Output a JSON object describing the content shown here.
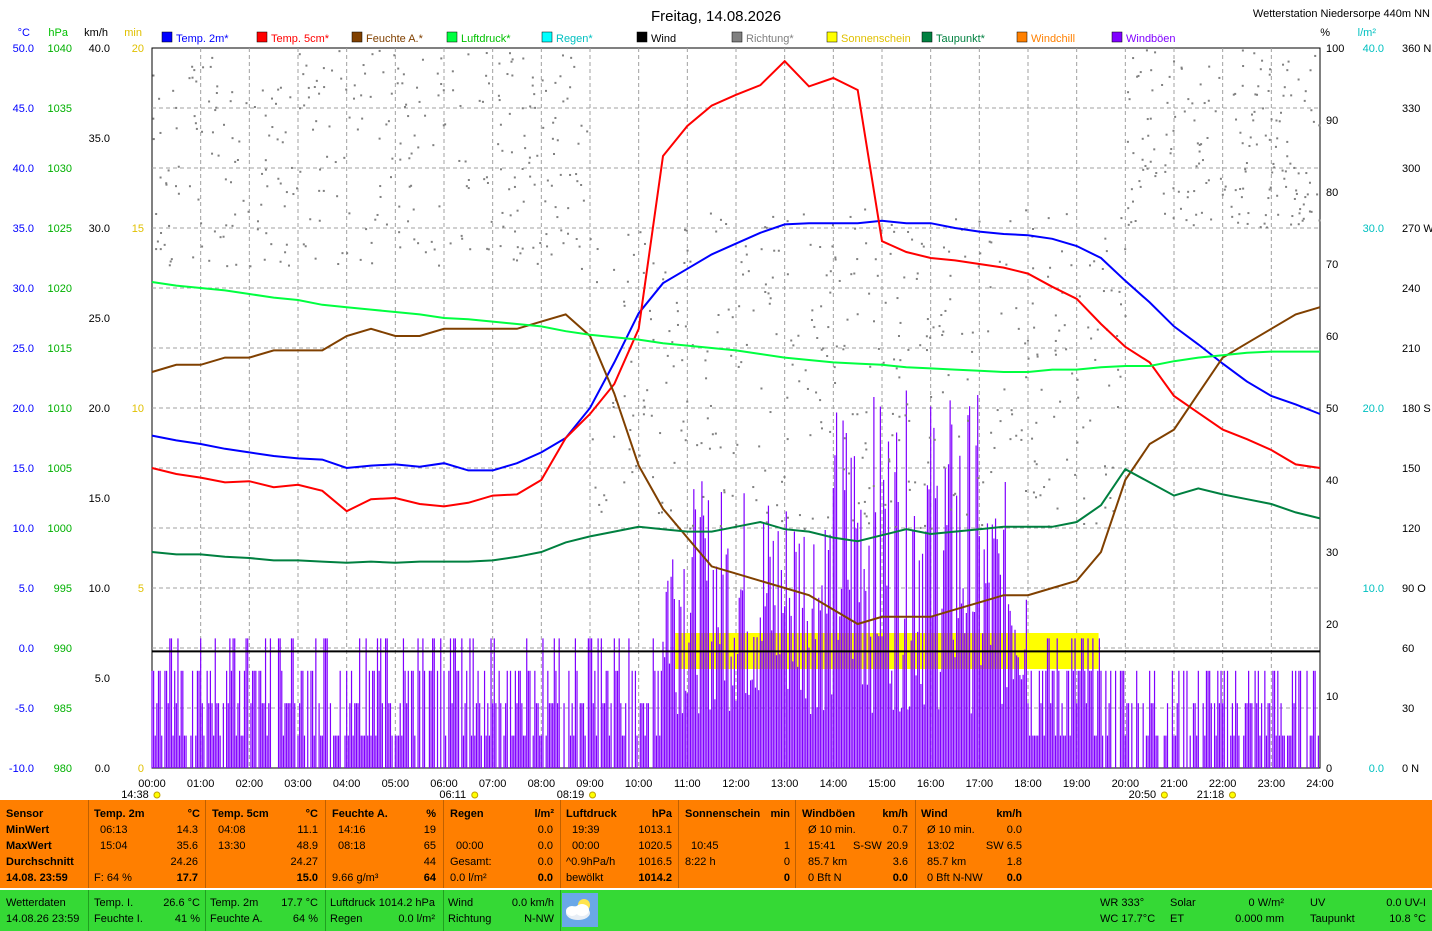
{
  "header": {
    "date_title": "Freitag, 14.08.2026",
    "station": "Wetterstation Niedersorpe 440m NN"
  },
  "legend": [
    {
      "label": "Temp. 2m*",
      "color": "#0000ff",
      "name": "legend-temp2m"
    },
    {
      "label": "Temp. 5cm*",
      "color": "#ff0000",
      "name": "legend-temp5cm"
    },
    {
      "label": "Feuchte A.*",
      "color": "#804000",
      "name": "legend-feuchte"
    },
    {
      "label": "Luftdruck*",
      "color": "#00ff40",
      "name": "legend-luftdruck"
    },
    {
      "label": "Regen*",
      "color": "#00ffff",
      "name": "legend-regen"
    },
    {
      "label": "Wind",
      "color": "#000000",
      "name": "legend-wind"
    },
    {
      "label": "Richtung*",
      "color": "#808080",
      "name": "legend-richtung"
    },
    {
      "label": "Sonnenschein",
      "color": "#ffff00",
      "name": "legend-sonnenschein"
    },
    {
      "label": "Taupunkt*",
      "color": "#008040",
      "name": "legend-taupunkt"
    },
    {
      "label": "Windchill",
      "color": "#ff8000",
      "name": "legend-windchill"
    },
    {
      "label": "Windböen",
      "color": "#8000ff",
      "name": "legend-windboeen"
    }
  ],
  "axis_units": {
    "temp": "°C",
    "hpa": "hPa",
    "kmh": "km/h",
    "min": "min",
    "percent": "%",
    "lm2": "l/m²"
  },
  "axes": {
    "temp": [
      "50.0",
      "45.0",
      "40.0",
      "35.0",
      "30.0",
      "25.0",
      "20.0",
      "15.0",
      "10.0",
      "5.0",
      "0.0",
      "-5.0",
      "-10.0"
    ],
    "hpa": [
      "1040",
      "1035",
      "1030",
      "1025",
      "1020",
      "1015",
      "1010",
      "1005",
      "1000",
      "995",
      "990",
      "985",
      "980"
    ],
    "kmh": [
      "40.0",
      "35.0",
      "30.0",
      "25.0",
      "20.0",
      "15.0",
      "10.0",
      "5.0",
      "0.0"
    ],
    "min": [
      "20",
      "15",
      "10",
      "5",
      "0"
    ],
    "percent": [
      "100",
      "90",
      "80",
      "70",
      "60",
      "50",
      "40",
      "30",
      "20",
      "10",
      "0"
    ],
    "lm2": [
      "40.0",
      "30.0",
      "20.0",
      "10.0",
      "0.0"
    ],
    "dir": [
      "360 N",
      "330",
      "300",
      "270 W",
      "240",
      "210",
      "180 S",
      "150",
      "120",
      "90 O",
      "60",
      "30",
      "0 N"
    ],
    "time": [
      "00:00",
      "01:00",
      "02:00",
      "03:00",
      "04:00",
      "05:00",
      "06:00",
      "07:00",
      "08:00",
      "09:00",
      "10:00",
      "11:00",
      "12:00",
      "13:00",
      "14:00",
      "15:00",
      "16:00",
      "17:00",
      "18:00",
      "19:00",
      "20:00",
      "21:00",
      "22:00",
      "23:00",
      "24:00"
    ]
  },
  "astro": {
    "moonrise": "14:38",
    "sunrise": "06:11",
    "sunrise2": "08:19",
    "sunset": "20:50",
    "sunset2": "21:18"
  },
  "chart_data": {
    "type": "line",
    "title": "Freitag, 14.08.2026",
    "x": [
      0,
      0.5,
      1,
      1.5,
      2,
      2.5,
      3,
      3.5,
      4,
      4.5,
      5,
      5.5,
      6,
      6.5,
      7,
      7.5,
      8,
      8.5,
      9,
      9.5,
      10,
      10.5,
      11,
      11.5,
      12,
      12.5,
      13,
      13.5,
      14,
      14.5,
      15,
      15.5,
      16,
      16.5,
      17,
      17.5,
      18,
      18.5,
      19,
      19.5,
      20,
      20.5,
      21,
      21.5,
      22,
      22.5,
      23,
      23.5,
      24
    ],
    "series": [
      {
        "name": "Temp. 2m*",
        "axis": "°C",
        "color": "#0000ff",
        "values": [
          17.7,
          17.3,
          17.0,
          16.6,
          16.3,
          16.0,
          15.8,
          15.7,
          15.0,
          15.2,
          15.3,
          15.1,
          15.4,
          14.8,
          14.8,
          15.4,
          16.3,
          17.5,
          20.0,
          23.8,
          27.9,
          30.4,
          31.6,
          32.8,
          33.7,
          34.6,
          35.3,
          35.4,
          35.4,
          35.4,
          35.6,
          35.4,
          35.4,
          35.0,
          34.7,
          34.5,
          34.4,
          34.1,
          33.5,
          32.5,
          30.6,
          28.8,
          26.8,
          25.3,
          23.7,
          22.2,
          21.0,
          20.3,
          19.5
        ]
      },
      {
        "name": "Temp. 5cm*",
        "axis": "°C",
        "color": "#ff0000",
        "values": [
          15.0,
          14.5,
          14.2,
          13.8,
          13.9,
          13.4,
          13.6,
          13.1,
          11.4,
          12.4,
          12.5,
          12.0,
          11.8,
          12.1,
          12.7,
          12.8,
          14.0,
          17.5,
          19.5,
          22.0,
          26.6,
          41.0,
          43.5,
          45.2,
          46.1,
          46.9,
          48.9,
          46.8,
          47.5,
          46.5,
          33.9,
          33.0,
          32.5,
          32.3,
          32.0,
          31.7,
          31.2,
          30.1,
          29.1,
          27.0,
          25.1,
          23.8,
          21.0,
          19.6,
          18.2,
          17.4,
          16.5,
          15.3,
          15.0
        ]
      },
      {
        "name": "Feuchte A.*",
        "axis": "%",
        "color": "#804000",
        "values": [
          55,
          56,
          56,
          57,
          57,
          58,
          58,
          58,
          60,
          61,
          60,
          60,
          61,
          61,
          61,
          61,
          62,
          63,
          60,
          52,
          42,
          36,
          32,
          28,
          27,
          26,
          25,
          24,
          22,
          20,
          21,
          21,
          21,
          22,
          23,
          24,
          24,
          25,
          26,
          30,
          40,
          45,
          47,
          52,
          57,
          59,
          61,
          63,
          64
        ]
      },
      {
        "name": "Luftdruck*",
        "axis": "hPa",
        "color": "#00ff40",
        "values": [
          1020.5,
          1020.2,
          1020.0,
          1019.8,
          1019.5,
          1019.2,
          1019.0,
          1018.6,
          1018.4,
          1018.2,
          1018.0,
          1017.8,
          1017.5,
          1017.4,
          1017.2,
          1017.0,
          1016.8,
          1016.4,
          1016.1,
          1015.9,
          1015.7,
          1015.4,
          1015.2,
          1015.0,
          1014.8,
          1014.5,
          1014.2,
          1014.0,
          1013.8,
          1013.7,
          1013.6,
          1013.4,
          1013.3,
          1013.2,
          1013.1,
          1013.0,
          1013.0,
          1013.2,
          1013.2,
          1013.4,
          1013.5,
          1013.5,
          1013.9,
          1014.2,
          1014.4,
          1014.6,
          1014.7,
          1014.7,
          1014.7
        ]
      },
      {
        "name": "Taupunkt*",
        "axis": "°C",
        "color": "#008040",
        "values": [
          8.0,
          7.8,
          7.8,
          7.6,
          7.5,
          7.3,
          7.3,
          7.2,
          7.1,
          7.2,
          7.1,
          7.2,
          7.2,
          7.2,
          7.3,
          7.6,
          8.0,
          8.8,
          9.3,
          9.7,
          10.1,
          9.9,
          9.7,
          9.7,
          10.1,
          10.5,
          9.9,
          9.7,
          9.2,
          8.9,
          9.4,
          9.9,
          9.5,
          9.7,
          9.9,
          10.1,
          10.1,
          10.1,
          10.5,
          11.9,
          14.9,
          13.8,
          12.7,
          13.3,
          12.8,
          12.4,
          12.0,
          11.3,
          10.8
        ]
      }
    ],
    "wind_kmh": {
      "mean_level": 5.4,
      "max": 6.5
    },
    "gusts_kmh": {
      "max": 20.9
    },
    "sunshine_bars": {
      "from": 10.75,
      "to": 19.45
    }
  },
  "table": {
    "col_sensor": {
      "title": "Sensor",
      "rows": [
        "MinWert",
        "MaxWert",
        "Durchschnitt"
      ],
      "footer_date": "14.08. 23:59"
    },
    "col_temp2m": {
      "title": "Temp. 2m",
      "unit": "°C",
      "min_time": "06:13",
      "min": "14.3",
      "max_time": "15:04",
      "max": "35.6",
      "avg": "24.26",
      "footer_label": "F: 64 %",
      "footer_val": "17.7"
    },
    "col_temp5cm": {
      "title": "Temp. 5cm",
      "unit": "°C",
      "min_time": "04:08",
      "min": "11.1",
      "max_time": "13:30",
      "max": "48.9",
      "avg": "24.27",
      "footer_val": "15.0"
    },
    "col_feuchte": {
      "title": "Feuchte A.",
      "unit": "%",
      "min_time": "14:16",
      "min": "19",
      "max_time": "08:18",
      "max": "65",
      "avg": "44",
      "footer_label": "9.66 g/m³",
      "footer_val": "64"
    },
    "col_regen": {
      "title": "Regen",
      "unit": "l/m²",
      "r1": "0.0",
      "r2_time": "00:00",
      "r2": "0.0",
      "r3_label": "Gesamt:",
      "r3": "0.0",
      "footer_label": "0.0 l/m²",
      "footer_val": "0.0"
    },
    "col_luftdruck": {
      "title": "Luftdruck",
      "unit": "hPa",
      "min_time": "19:39",
      "min": "1013.1",
      "max_time": "00:00",
      "max": "1020.5",
      "avg_label": "^0.9hPa/h",
      "avg": "1016.5",
      "footer_label": "bewölkt",
      "footer_val": "1014.2"
    },
    "col_sonne": {
      "title": "Sonnenschein",
      "unit": "min",
      "r1": "",
      "r2_time": "10:45",
      "r2": "1",
      "r3_label": "8:22 h",
      "r3": "0",
      "footer_val": "0"
    },
    "col_boeen": {
      "title": "Windböen",
      "unit": "km/h",
      "r1_label": "Ø 10 min.",
      "r1": "0.7",
      "r2_time": "15:41",
      "r2_dir": "S-SW",
      "r2": "20.9",
      "r3_label": "85.7 km",
      "r3": "3.6",
      "footer_label": "0 Bft N",
      "footer_val": "0.0"
    },
    "col_wind": {
      "title": "Wind",
      "unit": "km/h",
      "r1_label": "Ø 10 min.",
      "r1": "0.0",
      "r2_time": "13:02",
      "r2": "SW 6.5",
      "r3_label": "85.7 km",
      "r3": "1.8",
      "footer_label": "0 Bft N-NW",
      "footer_val": "0.0"
    }
  },
  "bottom": {
    "wetterdaten": "Wetterdaten",
    "datetime": "14.08.26 23:59",
    "temp_i_label": "Temp. I.",
    "temp_i": "26.6 °C",
    "feuchte_i_label": "Feuchte I.",
    "feuchte_i": "41 %",
    "temp_2m_label": "Temp. 2m",
    "temp_2m": "17.7 °C",
    "feuchte_a_label": "Feuchte A.",
    "feuchte_a": "64 %",
    "luftdruck_label": "Luftdruck",
    "luftdruck": "1014.2 hPa",
    "regen_label": "Regen",
    "regen": "0.0 l/m²",
    "wind_label": "Wind",
    "wind": "0.0 km/h",
    "richtung_label": "Richtung",
    "richtung": "N-NW",
    "wr": "WR 333°",
    "wc": "WC 17.7°C",
    "solar_label": "Solar",
    "solar": "0 W/m²",
    "et_label": "ET",
    "et": "0.000 mm",
    "uv_label": "UV",
    "uv": "0.0 UV-I",
    "taupunkt_label": "Taupunkt",
    "taupunkt": "10.8 °C"
  }
}
